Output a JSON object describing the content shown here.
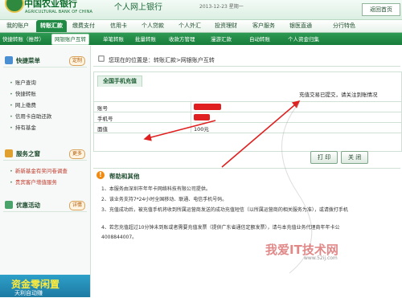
{
  "header": {
    "bank_cn": "中国农业银行",
    "bank_en": "AGRICULTURAL BANK OF CHINA",
    "portal": "个人网上银行",
    "date_text": "2013-12-23 星期一",
    "back_label": "返回首页"
  },
  "main_nav": {
    "items": [
      {
        "label": "我的账户"
      },
      {
        "label": "转账汇款"
      },
      {
        "label": "缴费支付"
      },
      {
        "label": "信用卡"
      },
      {
        "label": "个人贷款"
      },
      {
        "label": "个人外汇"
      },
      {
        "label": "投资理财"
      },
      {
        "label": "客户服务"
      },
      {
        "label": "银医直通"
      },
      {
        "label": "分行特色"
      }
    ]
  },
  "sub_nav": {
    "items": [
      {
        "label": "快捷转账（推荐）"
      },
      {
        "label": "网银账户互转"
      },
      {
        "label": "单笔转账"
      },
      {
        "label": "批量转账"
      },
      {
        "label": "收款方管理"
      },
      {
        "label": "漫游汇款"
      },
      {
        "label": "自动转账"
      },
      {
        "label": "个人资金归集"
      }
    ]
  },
  "sidebar": {
    "quick_menu": {
      "title": "快捷菜单",
      "button": "定制",
      "links": [
        "账户查询",
        "快捷转账",
        "网上缴费",
        "信用卡自助还款",
        "持有基金"
      ]
    },
    "service": {
      "title": "服务之窗",
      "button": "更多",
      "links": [
        "新新基金有奖问卷调查",
        "贵宾客户增值服务"
      ]
    },
    "promo_section": {
      "title": "优惠活动",
      "button": "详情"
    },
    "promo_banner": {
      "text": "资金零闲置",
      "sub": "天利自动赚"
    }
  },
  "breadcrumb": "您现在的位置是：转账汇款>网银账户互转",
  "form": {
    "tab": "全国手机充值",
    "status_message": "充值交易已提交，请关注到账情况",
    "rows": [
      {
        "label": "账号",
        "value": ""
      },
      {
        "label": "手机号",
        "value": ""
      },
      {
        "label": "面值",
        "value": "100元"
      }
    ]
  },
  "buttons": {
    "print": "打 印",
    "close": "关 闭"
  },
  "help": {
    "title": "帮助和其他",
    "items": [
      "1、本服务由深圳市年年卡网络科技有限公司提供。",
      "2、该业务支持7*24小时全国移动、联通、电信手机号码。",
      "3、充值成功后，被充值手机将收到所属运营商发送的成功充值短信（以所属运营商的相关服务为准），或请拨打手机",
      "4、若您充值超过10分钟未到账或者需要充值发票（提供广东省通信定额发票），请与本充值业务代理商年年卡公",
      "   4008844007。"
    ]
  },
  "watermark": {
    "text": "我爱IT技术网",
    "url": "www.52ij.com"
  },
  "colors": {
    "brand_green": "#1f8a43",
    "annotation_red": "#e02020"
  }
}
